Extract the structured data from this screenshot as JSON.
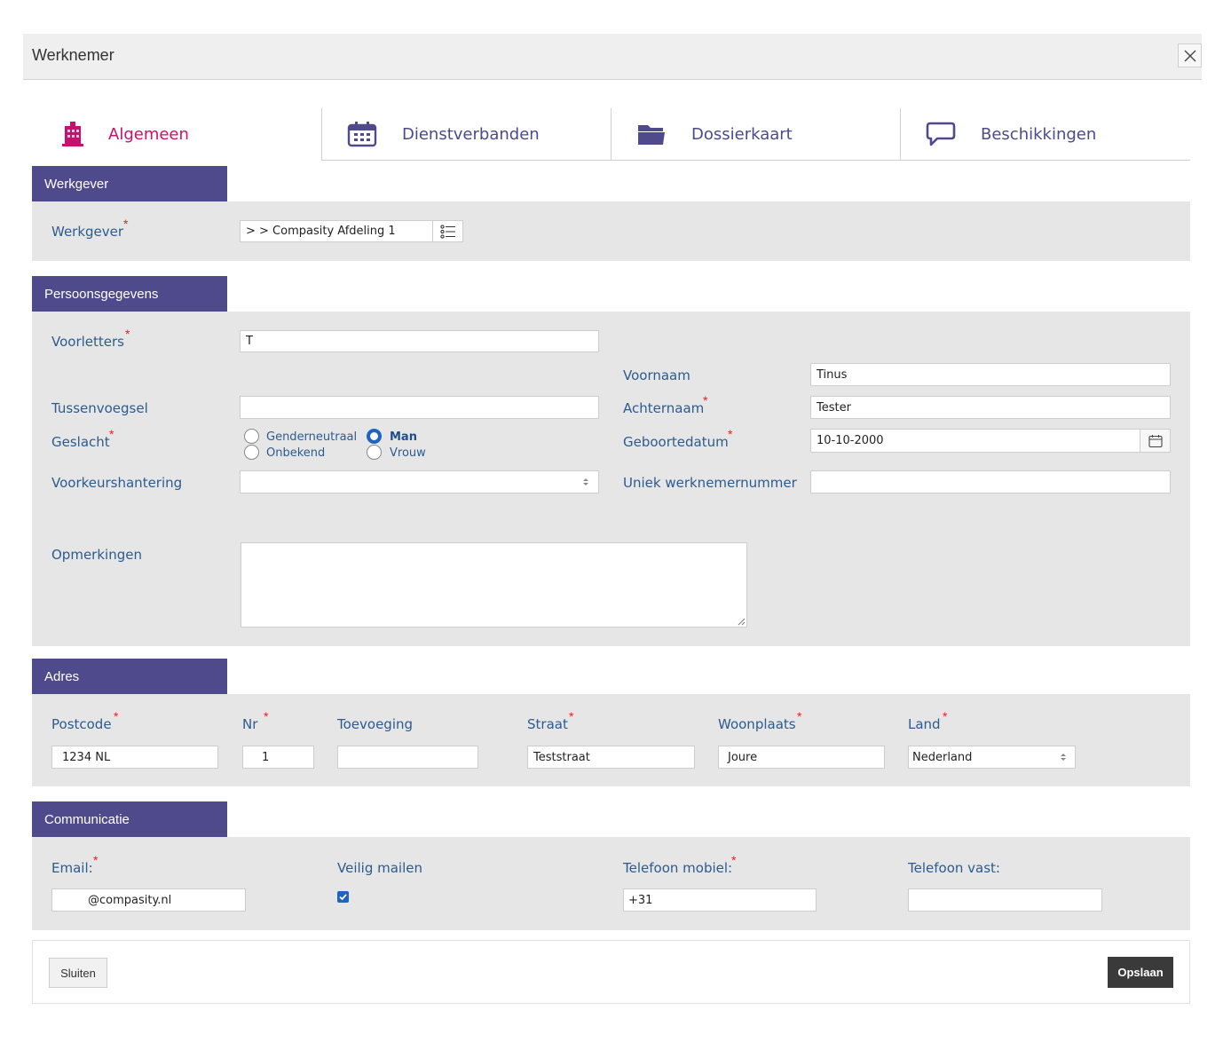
{
  "window": {
    "title": "Werknemer"
  },
  "tabs": [
    {
      "label": "Algemeen",
      "icon": "building-icon",
      "active": true
    },
    {
      "label": "Dienstverbanden",
      "icon": "calendar-icon",
      "active": false
    },
    {
      "label": "Dossierkaart",
      "icon": "folder-icon",
      "active": false
    },
    {
      "label": "Beschikkingen",
      "icon": "speech-bubble-icon",
      "active": false
    }
  ],
  "werkgever_section": {
    "header": "Werkgever",
    "label": "Werkgever",
    "value": ">  > Compasity Afdeling 1"
  },
  "persoon": {
    "header": "Persoonsgegevens",
    "voorletters_label": "Voorletters",
    "voorletters_value": "T",
    "voornaam_label": "Voornaam",
    "voornaam_value": "Tinus",
    "tussenvoegsel_label": "Tussenvoegsel",
    "tussenvoegsel_value": "",
    "achternaam_label": "Achternaam",
    "achternaam_value": "Tester",
    "geslacht_label": "Geslacht",
    "gender_options": [
      {
        "label": "Genderneutraal",
        "checked": false
      },
      {
        "label": "Onbekend",
        "checked": false
      },
      {
        "label": "Man",
        "checked": true
      },
      {
        "label": "Vrouw",
        "checked": false
      }
    ],
    "geboortedatum_label": "Geboortedatum",
    "geboortedatum_value": "10-10-2000",
    "voorkeur_label": "Voorkeurshantering",
    "voorkeur_value": "",
    "uniek_label": "Uniek werknemernummer",
    "uniek_value": "",
    "opmerkingen_label": "Opmerkingen",
    "opmerkingen_value": ""
  },
  "adres": {
    "header": "Adres",
    "postcode_label": "Postcode",
    "postcode_value": "1234 NL",
    "nr_label": "Nr",
    "nr_value": "1",
    "toevoeging_label": "Toevoeging",
    "toevoeging_value": "",
    "straat_label": "Straat",
    "straat_value": "Teststraat",
    "woonplaats_label": "Woonplaats",
    "woonplaats_value": "Joure",
    "land_label": "Land",
    "land_value": "Nederland"
  },
  "communicatie": {
    "header": "Communicatie",
    "email_label": "Email:",
    "email_value": "@compasity.nl",
    "veilig_label": "Veilig mailen",
    "veilig_checked": true,
    "mobiel_label": "Telefoon mobiel:",
    "mobiel_value": "+31",
    "vast_label": "Telefoon vast:",
    "vast_value": ""
  },
  "footer": {
    "close_label": "Sluiten",
    "save_label": "Opslaan"
  },
  "required_mark": "*",
  "colors": {
    "header_bg": "#4e4a8c",
    "active_tab": "#c8106e",
    "label": "#2b5b8f",
    "required": "#d9251d"
  }
}
